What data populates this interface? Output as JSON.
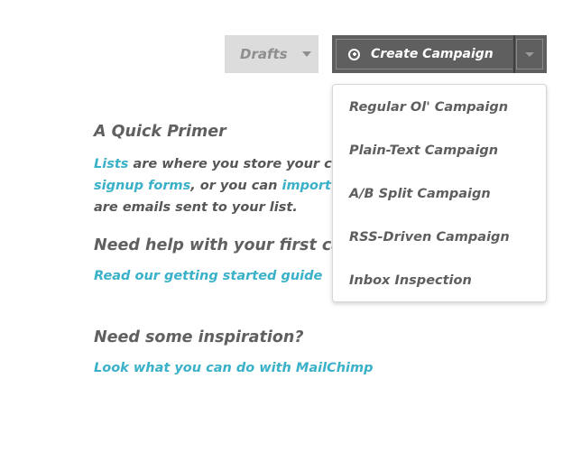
{
  "toolbar": {
    "drafts_label": "Drafts",
    "create_label": "Create Campaign"
  },
  "dropdown": {
    "items": [
      {
        "label": "Regular Ol' Campaign"
      },
      {
        "label": "Plain-Text Campaign"
      },
      {
        "label": "A/B Split Campaign"
      },
      {
        "label": "RSS-Driven Campaign"
      },
      {
        "label": "Inbox Inspection"
      }
    ]
  },
  "primer": {
    "heading": "A Quick Primer",
    "line1_link": "Lists",
    "line1_text": " are where you store your con",
    "line2_link_a": "signup forms",
    "line2_text": ", or you can ",
    "line2_link_b": "import co",
    "line3_text": "are emails sent to your list."
  },
  "help": {
    "heading": "Need help with your first ca",
    "link": "Read our getting started guide"
  },
  "inspiration": {
    "heading": "Need some inspiration?",
    "link": "Look what you can do with MailChimp"
  },
  "colors": {
    "link": "#3ab1c8",
    "text": "#565656",
    "button_dark": "#5f5f5f",
    "button_light": "#dcdcdc"
  },
  "icons": {
    "create": "plus-circle-icon",
    "caret": "chevron-down-icon"
  }
}
